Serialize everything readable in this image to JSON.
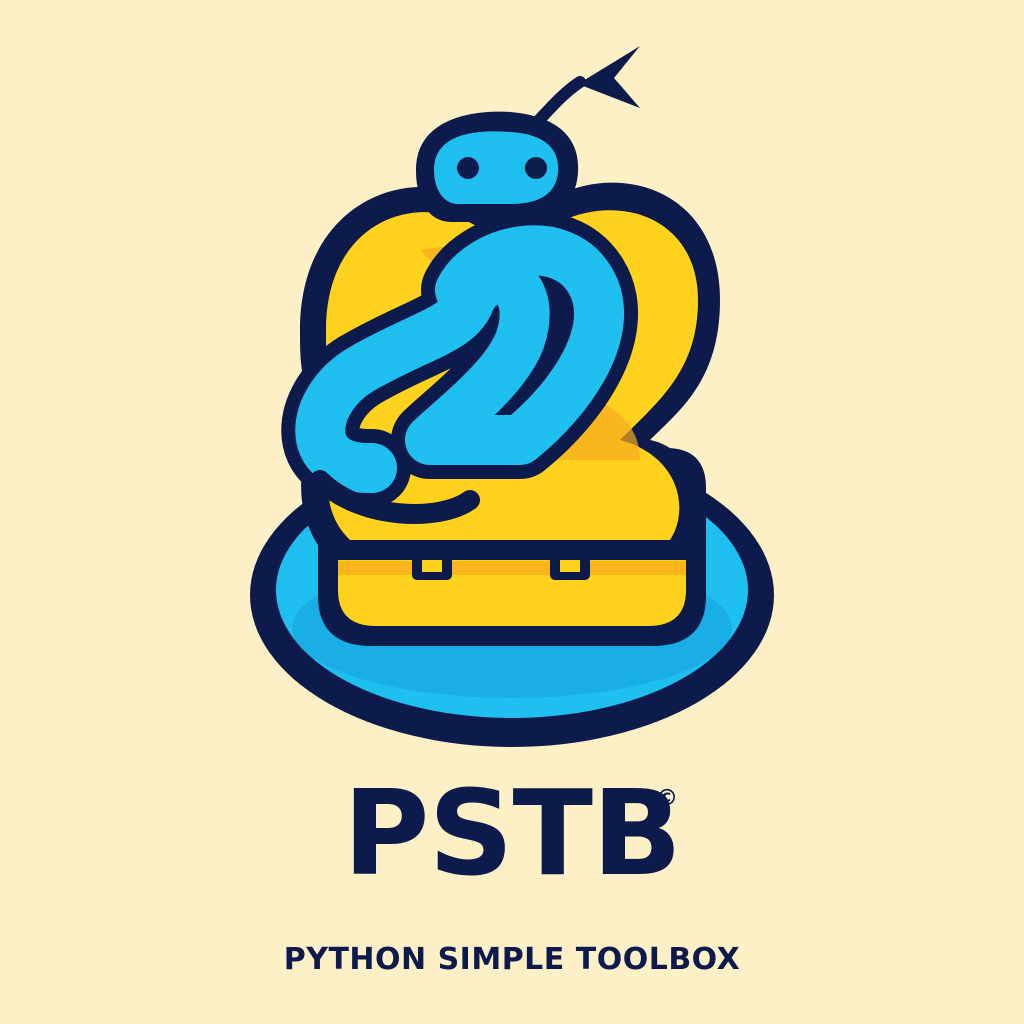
{
  "logo": {
    "icon": "snake-coiled-around-number-2-with-backpack",
    "brand_name": "PSTB",
    "copyright_symbol": "©",
    "tagline": "PYTHON SIMPLE TOOLBOX"
  },
  "colors": {
    "background": "#fdf0c6",
    "outline": "#0d1b4c",
    "snake_blue": "#1fc0f0",
    "number_yellow": "#ffd21e",
    "shadow_orange": "#f8a91c"
  }
}
